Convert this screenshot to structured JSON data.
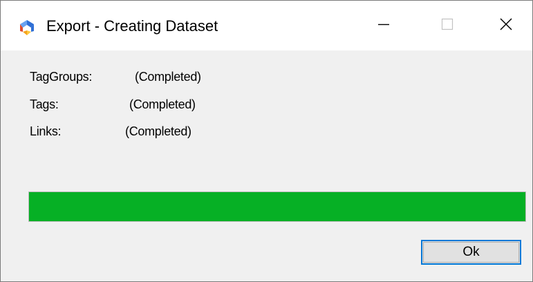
{
  "window": {
    "title": "Export - Creating Dataset",
    "app_icon": "app-logo-icon",
    "controls": {
      "minimize_icon": "minimize-icon",
      "maximize_icon": "maximize-icon",
      "close_icon": "close-icon"
    }
  },
  "status": {
    "items": [
      {
        "label": "TagGroups:",
        "value": "(Completed)"
      },
      {
        "label": "Tags:",
        "value": "(Completed)"
      },
      {
        "label": "Links:",
        "value": "(Completed)"
      }
    ]
  },
  "progress": {
    "percent": 100,
    "color": "#06b025"
  },
  "actions": {
    "ok_label": "Ok"
  },
  "colors": {
    "accent": "#0078d7",
    "progress": "#06b025"
  }
}
